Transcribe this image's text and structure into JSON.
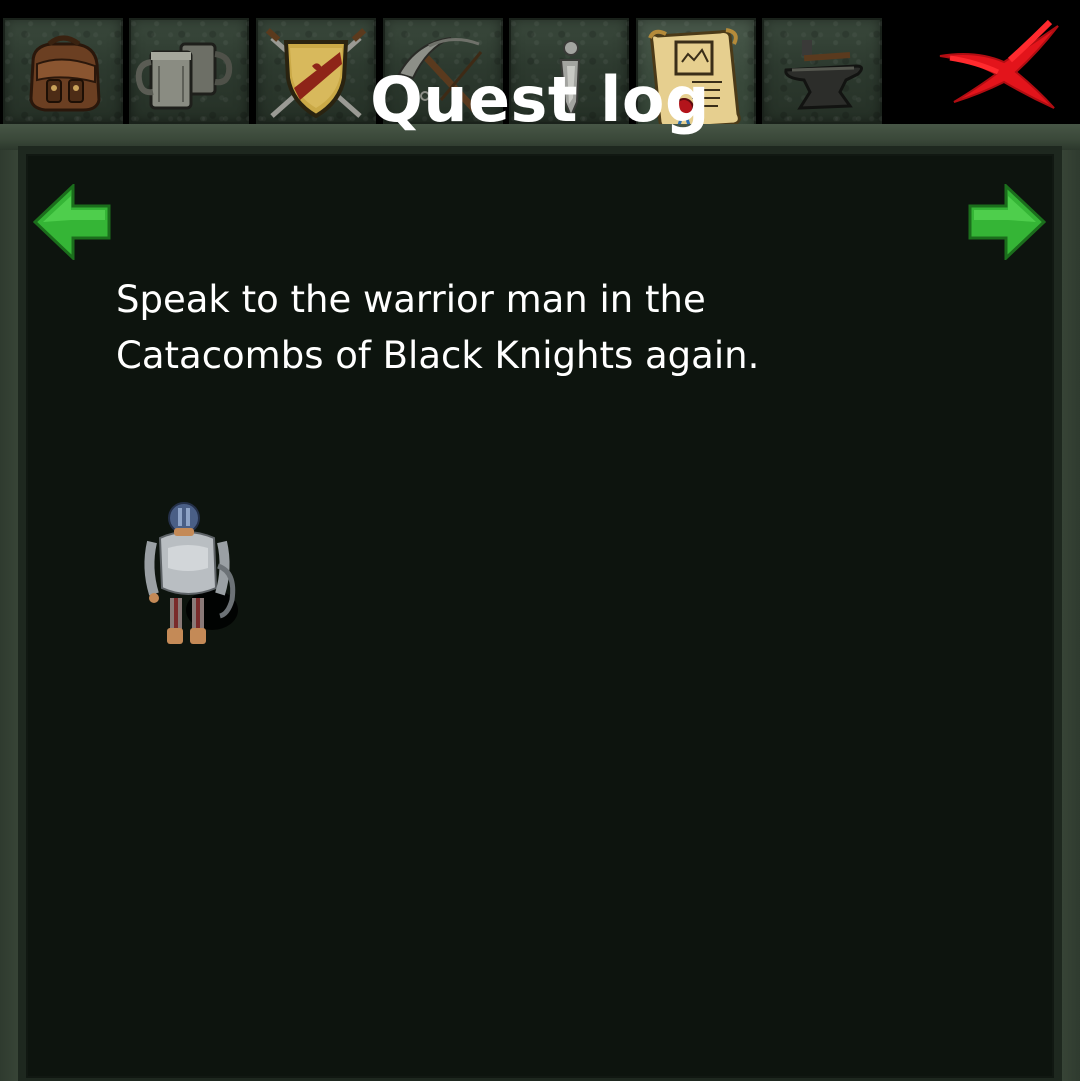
{
  "tabs": [
    {
      "id": "inventory",
      "icon": "backpack-icon"
    },
    {
      "id": "tavern",
      "icon": "tankards-icon"
    },
    {
      "id": "equipment",
      "icon": "shield-swords-icon"
    },
    {
      "id": "skills",
      "icon": "pickaxe-icon"
    },
    {
      "id": "info",
      "icon": "info-icon"
    },
    {
      "id": "quests",
      "icon": "quest-scroll-icon",
      "active": true
    },
    {
      "id": "crafting",
      "icon": "anvil-icon"
    }
  ],
  "close": {
    "icon": "close-x-icon"
  },
  "quest_log": {
    "title": "Quest log",
    "description": "Speak to the warrior man in the Catacombs of Black Knights again.",
    "prev_icon": "arrow-left-icon",
    "next_icon": "arrow-right-icon",
    "npc_icon": "warrior-npc-icon"
  },
  "colors": {
    "panel_bg": "#0d140e",
    "frame": "#3a473a",
    "tab_bg": "#2d3a2f",
    "arrow_green": "#3cc43a",
    "close_red": "#e0141a",
    "text": "#ffffff"
  }
}
